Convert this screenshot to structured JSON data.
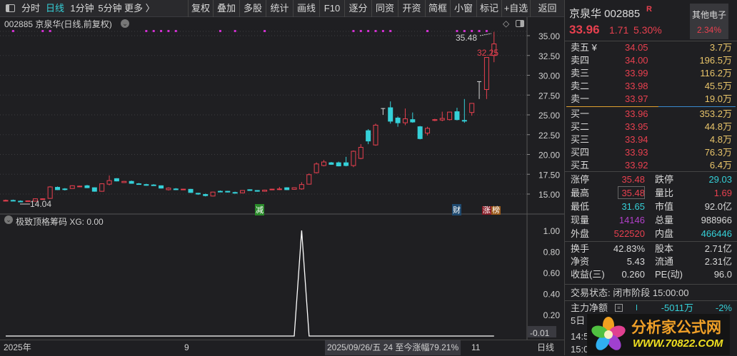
{
  "toolbar": {
    "period_tabs": [
      "分时",
      "日线",
      "1分钟",
      "5分钟",
      "更多 〉"
    ],
    "buttons": [
      "复权",
      "叠加",
      "多股",
      "统计",
      "画线",
      "F10",
      "逐分",
      "同资",
      "开资",
      "简框",
      "小窗",
      "标记",
      "+自选",
      "返回"
    ]
  },
  "chart_header": {
    "title": "002885 京泉华(日线,前复权)"
  },
  "price_axis": [
    "35.00",
    "32.50",
    "30.00",
    "27.50",
    "25.00",
    "22.50",
    "20.00",
    "17.50",
    "15.00"
  ],
  "annotations": {
    "high_label": "35.48",
    "last_label": "32.25",
    "low_label": "14.04",
    "badge_jian": "减",
    "badge_cai": "财",
    "badge_zhang": "涨",
    "badge_bang": "榜"
  },
  "indicator": {
    "title": "极致顶格筹码 XG: 0.00",
    "axis": [
      "1.00",
      "0.80",
      "0.60",
      "0.40",
      "0.20",
      "-0.01"
    ],
    "values": [
      0,
      0,
      0,
      0,
      0,
      0,
      0,
      0,
      0,
      0,
      0,
      0,
      0,
      0,
      0,
      0,
      0,
      0,
      0,
      0,
      0,
      0,
      0,
      0,
      0,
      0,
      0,
      0,
      0,
      0,
      0,
      0,
      0,
      0,
      0,
      0,
      0,
      0,
      0,
      0,
      1,
      0,
      0,
      0,
      0,
      0,
      0,
      0,
      0,
      0,
      0,
      0,
      0,
      0,
      0,
      0,
      0,
      0,
      0,
      0,
      0,
      0,
      0,
      0,
      0,
      0,
      0
    ]
  },
  "time_axis": {
    "year": "2025年",
    "m9": "9",
    "cursor": "2025/09/26/五 24 至今涨幅79.21%",
    "m11": "11",
    "period": "日线"
  },
  "colors": {
    "up": "#e8404f",
    "down": "#35d0d8",
    "doji": "#d8d8d8",
    "signal": "#d030d0"
  },
  "chart_data": {
    "type": "candlestick",
    "ylim": [
      15,
      35
    ],
    "candles": [
      [
        14.15,
        14.3,
        14.1,
        14.2
      ],
      [
        14.2,
        14.3,
        14.1,
        14.15
      ],
      [
        14.1,
        14.2,
        14.04,
        14.05
      ],
      [
        14.05,
        14.2,
        14.0,
        14.15
      ],
      [
        14.1,
        14.45,
        14.05,
        14.4
      ],
      [
        14.35,
        14.45,
        14.3,
        14.4
      ],
      [
        14.45,
        16.0,
        14.4,
        15.9
      ],
      [
        15.85,
        15.95,
        15.5,
        15.55
      ],
      [
        15.65,
        15.75,
        15.45,
        15.6
      ],
      [
        15.7,
        16.1,
        15.7,
        16.05
      ],
      [
        15.98,
        16.05,
        15.9,
        16.0
      ],
      [
        16.05,
        16.15,
        15.75,
        15.8
      ],
      [
        15.8,
        15.85,
        15.3,
        15.35
      ],
      [
        15.35,
        16.35,
        15.3,
        16.3
      ],
      [
        16.25,
        17.35,
        16.1,
        16.7
      ],
      [
        16.95,
        17.0,
        16.6,
        16.65
      ],
      [
        16.45,
        16.65,
        16.4,
        16.6
      ],
      [
        16.6,
        16.7,
        16.3,
        16.35
      ],
      [
        16.3,
        16.4,
        16.2,
        16.25
      ],
      [
        16.2,
        16.3,
        16.05,
        16.1
      ],
      [
        16.15,
        16.25,
        16.05,
        16.1
      ],
      [
        16.05,
        16.1,
        15.7,
        15.75
      ],
      [
        15.55,
        15.85,
        15.45,
        15.75
      ],
      [
        15.65,
        15.75,
        15.5,
        15.55
      ],
      [
        15.6,
        15.65,
        15.55,
        15.62
      ],
      [
        15.6,
        15.65,
        15.15,
        15.2
      ],
      [
        15.1,
        15.15,
        14.9,
        15.0
      ],
      [
        14.95,
        15.05,
        14.7,
        14.8
      ],
      [
        14.75,
        15.3,
        14.7,
        15.25
      ],
      [
        15.35,
        15.45,
        15.25,
        15.3
      ],
      [
        15.35,
        15.4,
        15.2,
        15.25
      ],
      [
        15.2,
        15.3,
        15.05,
        15.15
      ],
      [
        15.15,
        15.5,
        15.1,
        15.45
      ],
      [
        15.55,
        15.6,
        15.4,
        15.45
      ],
      [
        15.45,
        15.5,
        15.3,
        15.35
      ],
      [
        15.35,
        15.55,
        15.3,
        15.5
      ],
      [
        15.6,
        15.65,
        15.55,
        15.62
      ],
      [
        15.6,
        15.9,
        15.5,
        15.65
      ],
      [
        15.8,
        15.85,
        15.5,
        15.55
      ],
      [
        15.6,
        15.85,
        15.55,
        15.8
      ],
      [
        15.65,
        16.5,
        15.55,
        16.2
      ],
      [
        16.25,
        17.6,
        16.2,
        17.45
      ],
      [
        17.7,
        19.0,
        17.6,
        18.8
      ],
      [
        18.6,
        19.3,
        18.5,
        19.05
      ],
      [
        18.95,
        19.05,
        18.7,
        18.75
      ],
      [
        18.95,
        19.1,
        18.5,
        18.55
      ],
      [
        18.95,
        19.7,
        18.5,
        18.6
      ],
      [
        18.6,
        20.5,
        18.4,
        20.4
      ],
      [
        19.5,
        21.3,
        19.4,
        20.9
      ],
      [
        23.0,
        23.2,
        21.3,
        21.7
      ],
      [
        21.2,
        23.9,
        21.1,
        23.7
      ],
      [
        25.8,
        25.85,
        25.0,
        25.8
      ],
      [
        25.9,
        26.7,
        23.9,
        24.2
      ],
      [
        24.6,
        24.8,
        23.5,
        24.0
      ],
      [
        24.0,
        25.8,
        23.7,
        24.5
      ],
      [
        24.4,
        25.3,
        24.0,
        24.1
      ],
      [
        23.5,
        23.6,
        21.9,
        22.0
      ],
      [
        22.7,
        23.5,
        22.4,
        23.3
      ],
      [
        24.3,
        24.5,
        24.2,
        24.4
      ],
      [
        24.35,
        25.4,
        24.2,
        24.55
      ],
      [
        24.4,
        25.4,
        24.3,
        25.35
      ],
      [
        25.4,
        25.9,
        24.3,
        24.4
      ],
      [
        24.3,
        27.0,
        24.0,
        24.25
      ],
      [
        25.3,
        26.45,
        24.9,
        26.45
      ],
      [
        29.2,
        29.2,
        27.0,
        29.2
      ],
      [
        28.2,
        32.25,
        27.0,
        32.25
      ],
      [
        32.5,
        35.48,
        31.65,
        33.96
      ]
    ],
    "signal_dots_candle_index": [
      1,
      5,
      6,
      19,
      20,
      21,
      22,
      23,
      29,
      31,
      35,
      47,
      48,
      49,
      50,
      51,
      52,
      57,
      61,
      62,
      63,
      64,
      65
    ]
  },
  "quote": {
    "name_code": "京泉华 002885",
    "r_badge": "R",
    "sector": "其他电子",
    "sector_change": "2.34%",
    "price": "33.96",
    "change": "1.71",
    "change_pct": "5.30%"
  },
  "order_book": {
    "sell": [
      [
        "卖五 ¥",
        "34.05",
        "3.7万"
      ],
      [
        "卖四",
        "34.00",
        "196.5万"
      ],
      [
        "卖三",
        "33.99",
        "116.2万"
      ],
      [
        "卖二",
        "33.98",
        "45.5万"
      ],
      [
        "卖一",
        "33.97",
        "19.0万"
      ]
    ],
    "buy": [
      [
        "买一",
        "33.96",
        "353.2万"
      ],
      [
        "买二",
        "33.95",
        "44.8万"
      ],
      [
        "买三",
        "33.94",
        "4.8万"
      ],
      [
        "买四",
        "33.93",
        "76.3万"
      ],
      [
        "买五",
        "33.92",
        "6.4万"
      ]
    ]
  },
  "stats": [
    [
      "涨停",
      "35.48",
      "跌停",
      "29.03"
    ],
    [
      "最高",
      "35.48",
      "量比",
      "1.69"
    ],
    [
      "最低",
      "31.65",
      "市值",
      "92.0亿"
    ],
    [
      "现量",
      "14146",
      "总量",
      "988966"
    ],
    [
      "外盘",
      "522520",
      "内盘",
      "466446"
    ]
  ],
  "fund": [
    [
      "换手",
      "42.83%",
      "股本",
      "2.71亿"
    ],
    [
      "净资",
      "5.43",
      "流通",
      "2.31亿"
    ],
    [
      "收益(三)",
      "0.260",
      "PE(动)",
      "96.0"
    ]
  ],
  "status": "交易状态: 闭市阶段 15:00:00",
  "main_flow": {
    "label": "主力净额",
    "value": "-5011万",
    "pct": "-2%"
  },
  "partial_rows": [
    "5日",
    "14:5",
    "15:0"
  ],
  "logo": {
    "cn": "分析家公式网",
    "url": "WWW.70822.COM"
  }
}
